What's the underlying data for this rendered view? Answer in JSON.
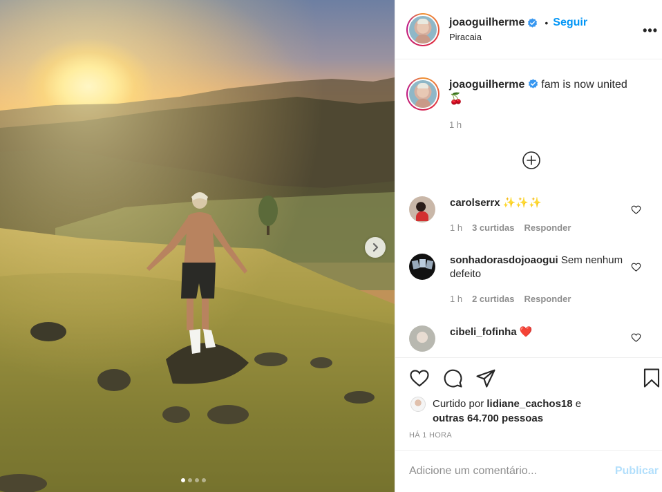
{
  "post": {
    "username": "joaoguilherme",
    "separator": "•",
    "follow_label": "Seguir",
    "location": "Piracaia",
    "more_label": "•••",
    "caption_text": "fam is now united",
    "caption_emoji": "🍒",
    "caption_time": "1 h"
  },
  "comments": [
    {
      "username": "carolserrx",
      "text": "✨✨✨",
      "time": "1 h",
      "likes": "3 curtidas",
      "reply": "Responder"
    },
    {
      "username": "sonhadorasdojoaogui",
      "text": "Sem nenhum defeito",
      "time": "1 h",
      "likes": "2 curtidas",
      "reply": "Responder"
    },
    {
      "username": "cibeli_fofinha",
      "text": "❤️"
    }
  ],
  "likes": {
    "prefix": "Curtido por",
    "user": "lidiane_cachos18",
    "and": "e",
    "others": "outras 64.700 pessoas"
  },
  "time_ago": "HÁ 1 HORA",
  "add_comment": {
    "placeholder": "Adicione um comentário...",
    "publish_label": "Publicar"
  },
  "carousel": {
    "total": 4,
    "current": 1
  },
  "colors": {
    "accent": "#0095f6",
    "publish_disabled": "#b2dffc",
    "heart": "#ed4956"
  }
}
